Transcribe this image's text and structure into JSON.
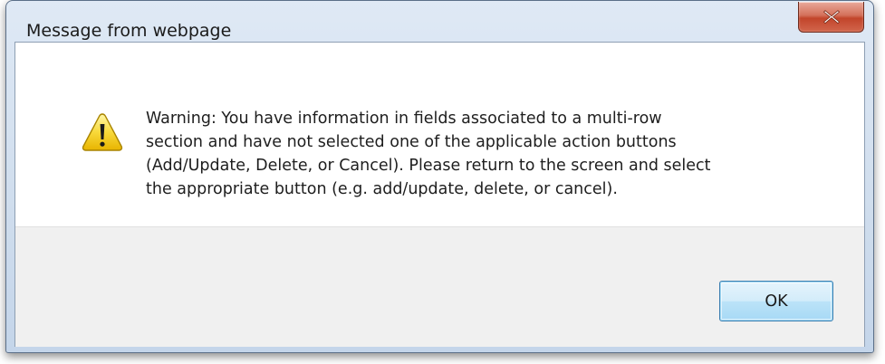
{
  "window": {
    "title": "Message from webpage"
  },
  "titlebar": {
    "close_icon": "close-icon"
  },
  "message": {
    "icon": "warning-icon",
    "lines": [
      "Warning: You have information in fields associated to a multi-row",
      "section and have not selected one of the applicable action buttons",
      "(Add/Update, Delete, or Cancel). Please return to the screen and select",
      "the appropriate button (e.g. add/update, delete, or cancel)."
    ]
  },
  "buttons": {
    "ok_label": "OK"
  },
  "colors": {
    "close_button": "#c2452b",
    "ok_button_border": "#3c7fb1",
    "warning_yellow": "#f5c400",
    "button_area_bg": "#f0f0f0"
  }
}
